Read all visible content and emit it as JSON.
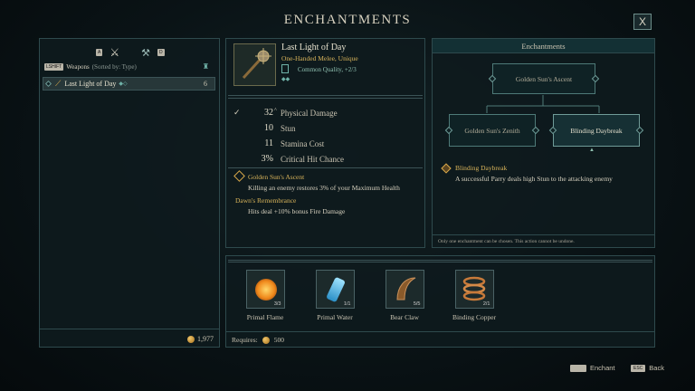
{
  "header": {
    "title": "ENCHANTMENTS",
    "close_label": "X"
  },
  "left_panel": {
    "key_a": "A",
    "key_d": "D",
    "shift_key": "LSHIFT",
    "category_label": "Weapons",
    "sort_label": "(Sorted by: Type)",
    "weapons": [
      {
        "name": "Last Light of Day",
        "count": "6"
      }
    ],
    "currency": "1,977"
  },
  "item": {
    "name": "Last Light of Day",
    "type": "One-Handed Melee, Unique",
    "quality": "Common Quality, +2/3",
    "stats": [
      {
        "value": "32",
        "label": "Physical Damage",
        "checked": true
      },
      {
        "value": "10",
        "label": "Stun",
        "checked": false
      },
      {
        "value": "11",
        "label": "Stamina Cost",
        "checked": false
      },
      {
        "value": "3%",
        "label": "Critical Hit Chance",
        "checked": false
      }
    ],
    "enchant_name": "Golden Sun's Ascent",
    "enchant_desc": "Killing an enemy restores 3% of your Maximum Health",
    "perk_name": "Dawn's Remembrance",
    "perk_desc": "Hits deal +10% bonus Fire Damage"
  },
  "enchantments": {
    "title": "Enchantments",
    "root": "Golden Sun's Ascent",
    "option_left": "Golden Sun's Zenith",
    "option_right": "Blinding Daybreak",
    "selected_name": "Blinding Daybreak",
    "selected_desc": "A successful Parry deals high Stun to the attacking enemy",
    "note": "Only one enchantment can be chosen. This action cannot be undone."
  },
  "materials": {
    "items": [
      {
        "name": "Primal Flame",
        "count": "3/3"
      },
      {
        "name": "Primal Water",
        "count": "1/1"
      },
      {
        "name": "Bear Claw",
        "count": "5/5"
      },
      {
        "name": "Binding Copper",
        "count": "2/1"
      }
    ],
    "requires_label": "Requires:",
    "requires_value": "500"
  },
  "footer": {
    "enchant_label": "Enchant",
    "back_key": "ESC",
    "back_label": "Back"
  },
  "colors": {
    "gold": "#d9a94a",
    "teal": "#4e7a78",
    "accent_text": "#d7b35a"
  }
}
